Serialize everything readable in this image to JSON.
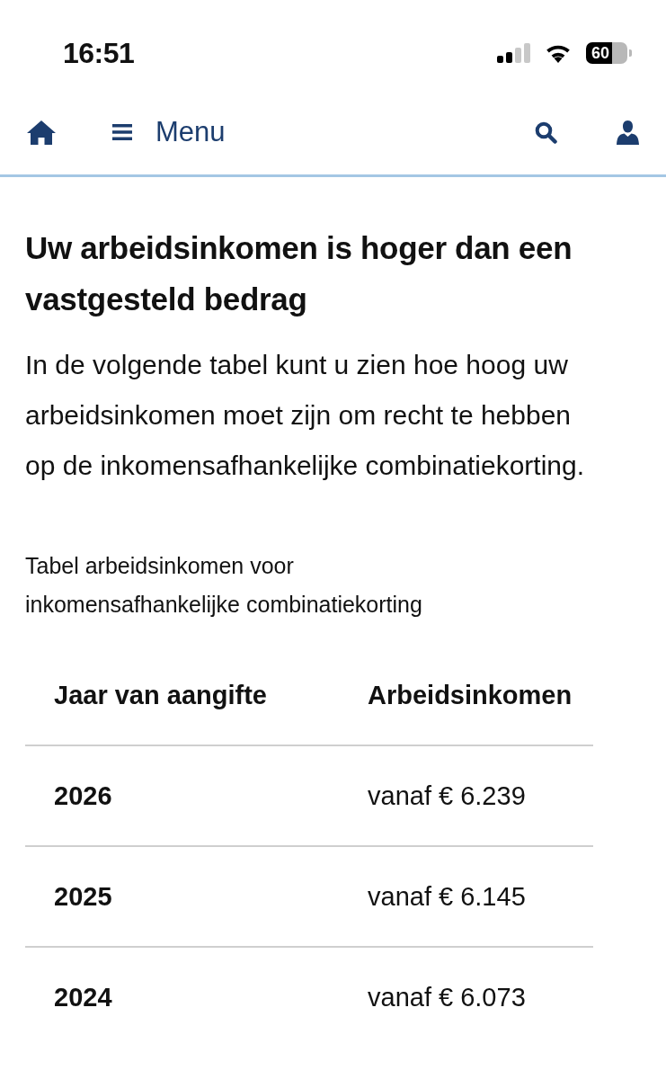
{
  "status_bar": {
    "time": "16:51",
    "battery": "60"
  },
  "nav": {
    "menu_label": "Menu"
  },
  "heading": "Uw arbeidsinkomen is hoger dan een vastgesteld bedrag",
  "intro": "In de volgende tabel kunt u zien hoe hoog uw arbeidsinkomen moet zijn om recht te hebben op de inkomensafhankelijke combinatiekorting.",
  "table": {
    "caption": "Tabel arbeidsinkomen voor inkomensafhankelijke combinatiekorting",
    "columns": [
      "Jaar van aangifte",
      "Arbeidsinkomen"
    ],
    "rows": [
      [
        "2026",
        "vanaf € 6.239"
      ],
      [
        "2025",
        "vanaf € 6.145"
      ],
      [
        "2024",
        "vanaf € 6.073"
      ]
    ]
  }
}
